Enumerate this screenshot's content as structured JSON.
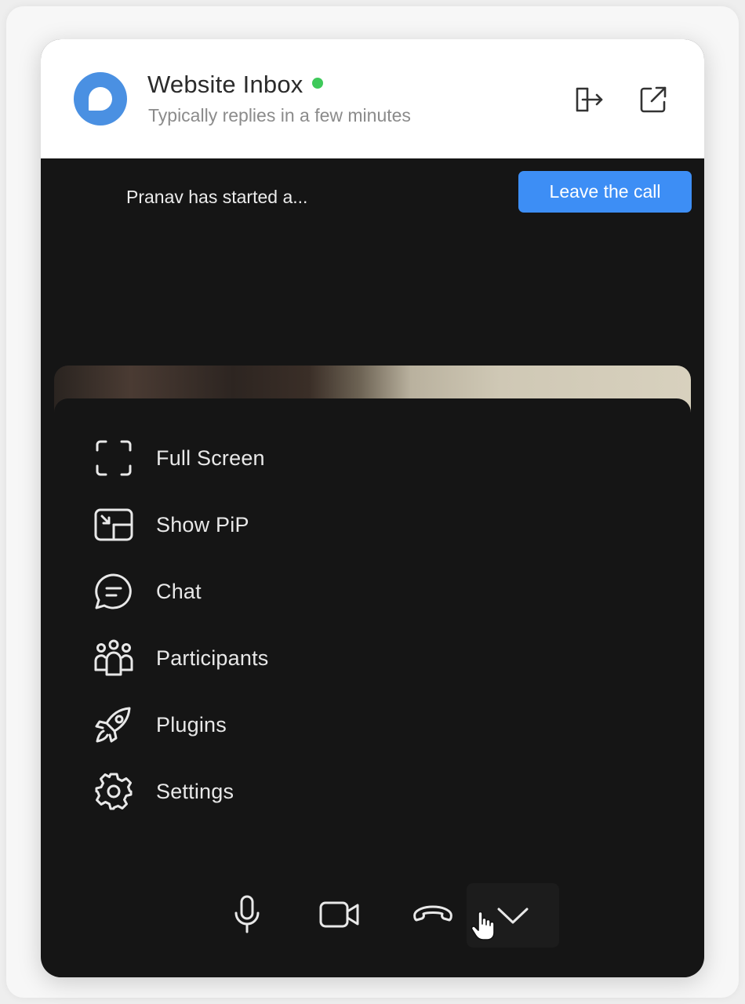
{
  "header": {
    "title": "Website Inbox",
    "subtitle": "Typically replies in a few minutes",
    "status_color": "#3ec95a",
    "avatar_color": "#4a90e2",
    "icons": [
      "exit-icon",
      "open-external-icon"
    ]
  },
  "call": {
    "banner_text": "Pranav has started a...",
    "leave_label": "Leave the call",
    "leave_color": "#3d8ef5"
  },
  "menu": {
    "items": [
      {
        "label": "Full Screen",
        "icon": "fullscreen-icon"
      },
      {
        "label": "Show PiP",
        "icon": "pip-icon"
      },
      {
        "label": "Chat",
        "icon": "chat-icon"
      },
      {
        "label": "Participants",
        "icon": "participants-icon"
      },
      {
        "label": "Plugins",
        "icon": "rocket-icon"
      },
      {
        "label": "Settings",
        "icon": "gear-icon"
      }
    ]
  },
  "controls": [
    "microphone-icon",
    "camera-icon",
    "hang-up-icon",
    "chevron-down-icon"
  ]
}
